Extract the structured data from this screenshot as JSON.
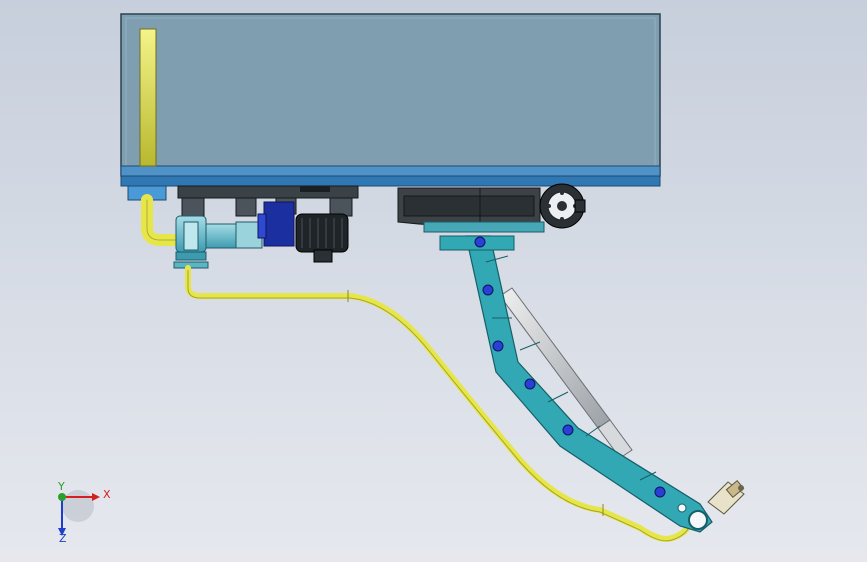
{
  "triad": {
    "x_label": "X",
    "y_label": "Y",
    "z_label": "Z",
    "x_color": "#d42020",
    "y_color": "#2aa02a",
    "z_color": "#1f3fc8"
  },
  "colors": {
    "tank_fill": "#7f9fb0",
    "tank_base": "#3e86bd",
    "pipe": "#e6e64a",
    "arm": "#32a8b4",
    "pin": "#2a3fd4",
    "motor": "#1f2428",
    "pump_blue": "#1b2fa0"
  }
}
